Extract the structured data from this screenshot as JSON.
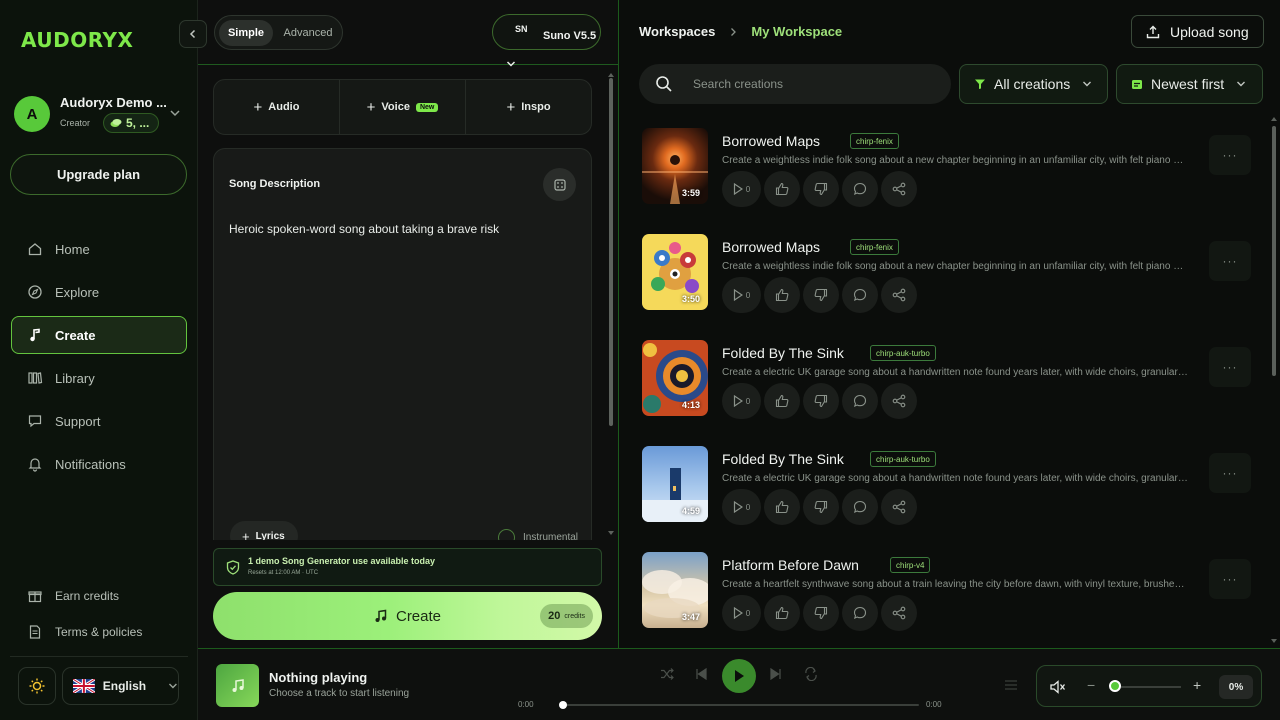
{
  "app": {
    "logo": "AUDORYX"
  },
  "user": {
    "name": "Audoryx Demo ...",
    "role": "Creator",
    "credits": "5, ..."
  },
  "sidebar": {
    "upgrade_label": "Upgrade plan",
    "items": [
      {
        "label": "Home",
        "icon": "home-icon",
        "active": false
      },
      {
        "label": "Explore",
        "icon": "compass-icon",
        "active": false
      },
      {
        "label": "Create",
        "icon": "music-note-icon",
        "active": true
      },
      {
        "label": "Library",
        "icon": "library-icon",
        "active": false
      },
      {
        "label": "Support",
        "icon": "chat-icon",
        "active": false
      },
      {
        "label": "Notifications",
        "icon": "bell-icon",
        "active": false
      }
    ],
    "footer_links": [
      {
        "label": "Earn credits",
        "icon": "gift-icon"
      },
      {
        "label": "Terms & policies",
        "icon": "document-icon"
      }
    ],
    "language": "English"
  },
  "create": {
    "mode_simple": "Simple",
    "mode_advanced": "Advanced",
    "model_badge": "SN",
    "model_name": "Suno V5.5",
    "tabs": {
      "audio": "Audio",
      "voice": "Voice",
      "voice_badge": "New",
      "inspo": "Inspo"
    },
    "description_title": "Song Description",
    "description_text": "Heroic spoken-word song about taking a brave risk",
    "lyrics_label": "Lyrics",
    "instrumental_label": "Instrumental",
    "demo_title": "1 demo Song Generator use available today",
    "demo_sub": "Resets at 12:00 AM · UTC",
    "create_label": "Create",
    "credits_value": "20",
    "credits_unit": "credits"
  },
  "library": {
    "crumb_root": "Workspaces",
    "crumb_current": "My Workspace",
    "upload_label": "Upload song",
    "search_placeholder": "Search creations",
    "filter_label": "All creations",
    "sort_label": "Newest first",
    "songs": [
      {
        "title": "Borrowed Maps",
        "model": "chirp-fenix",
        "desc": "Create a weightless indie folk song about a new chapter beginning in an unfamiliar city, with felt piano and airy layered harmonies",
        "duration": "3:59",
        "plays": "0"
      },
      {
        "title": "Borrowed Maps",
        "model": "chirp-fenix",
        "desc": "Create a weightless indie folk song about a new chapter beginning in an unfamiliar city, with felt piano and airy layered harmonies",
        "duration": "3:50",
        "plays": "0"
      },
      {
        "title": "Folded By The Sink",
        "model": "chirp-auk-turbo",
        "desc": "Create a electric UK garage song about a handwritten note found years later, with wide choirs, granular textures",
        "duration": "4:13",
        "plays": "0"
      },
      {
        "title": "Folded By The Sink",
        "model": "chirp-auk-turbo",
        "desc": "Create a electric UK garage song about a handwritten note found years later, with wide choirs, granular textures",
        "duration": "4:59",
        "plays": "0"
      },
      {
        "title": "Platform Before Dawn",
        "model": "chirp-v4",
        "desc": "Create a heartfelt synthwave song about a train leaving the city before dawn, with vinyl texture, brushed drums",
        "duration": "3:47",
        "plays": "0"
      }
    ]
  },
  "player": {
    "title": "Nothing playing",
    "subtitle": "Choose a track to start listening",
    "time_current": "0:00",
    "time_total": "0:00",
    "volume": "0%"
  }
}
